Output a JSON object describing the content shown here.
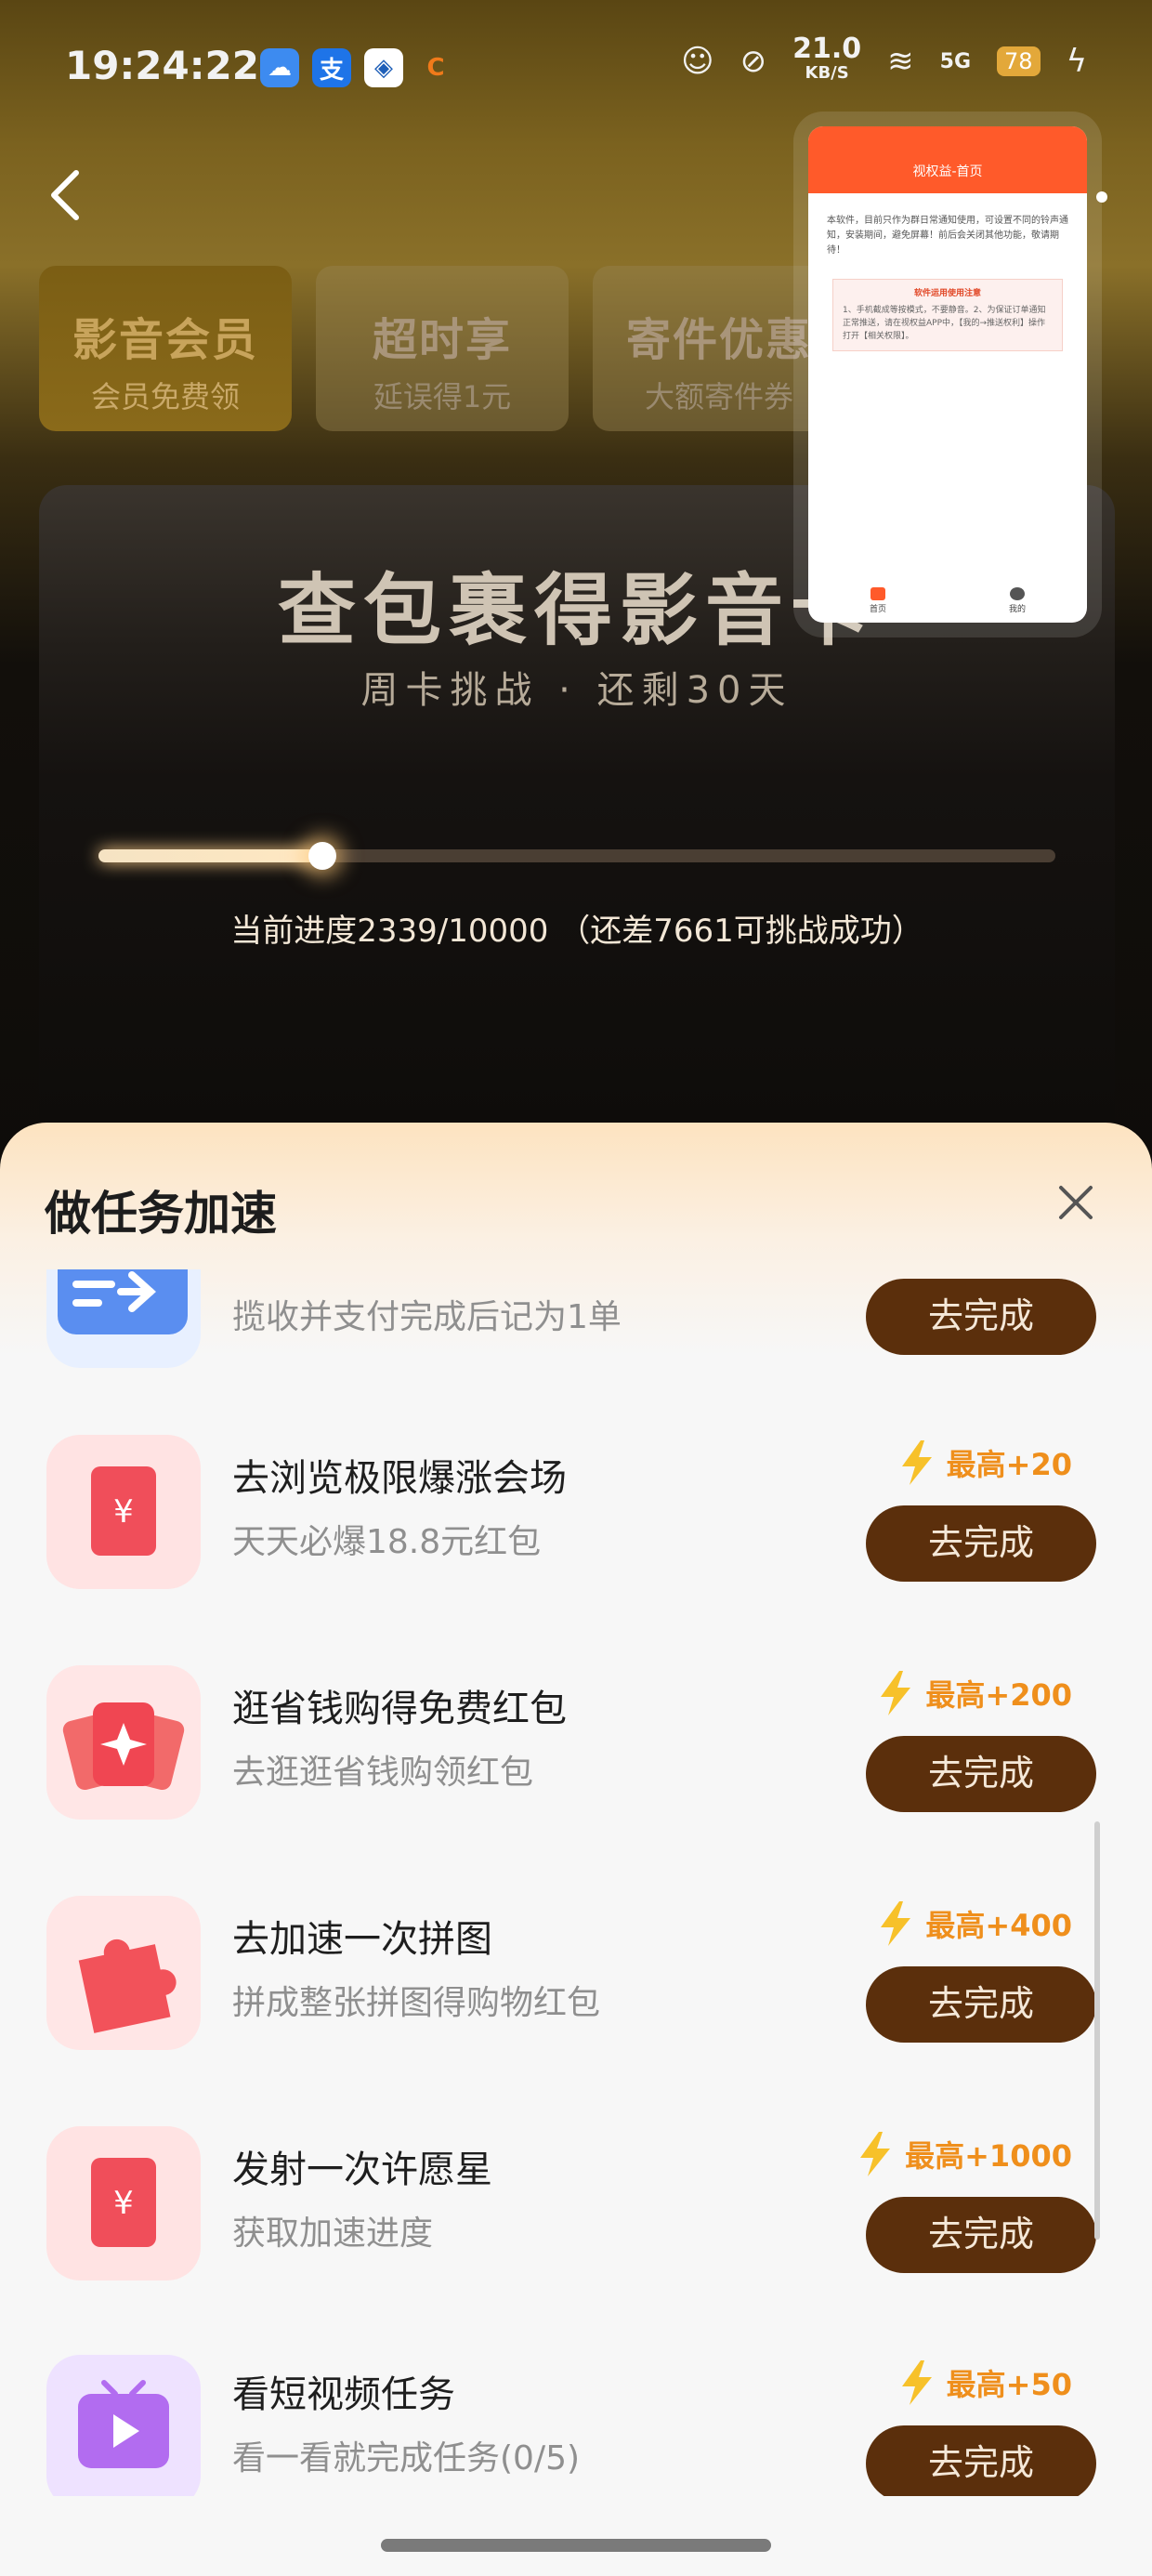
{
  "status_bar": {
    "time": "19:24:22",
    "net_speed_value": "21.0",
    "net_speed_unit": "KB/S",
    "signal": "5G",
    "battery": "78",
    "icons": [
      "weather-icon",
      "alipay-icon",
      "bank-icon",
      "app-icon",
      "cat-icon",
      "mute-icon",
      "wifi-icon",
      "signal-icon",
      "battery-icon",
      "charging-icon"
    ]
  },
  "tabs": [
    {
      "title": "影音会员",
      "subtitle": "会员免费领"
    },
    {
      "title": "超时享",
      "subtitle": "延误得1元"
    },
    {
      "title": "寄件优惠",
      "subtitle": "大额寄件券"
    }
  ],
  "hero": {
    "title": "查包裹得影音卡",
    "subtitle": "周卡挑战 · 还剩30天",
    "progress_current": 2339,
    "progress_total": 10000,
    "progress_text": "当前进度2339/10000 （还差7661可挑战成功）"
  },
  "mini_window": {
    "title": "视权益-首页",
    "paragraph": "本软件，目前只作为群日常通知使用，可设置不同的铃声通知，安装期间，避免屏幕！前后会关闭其他功能，敬请期待！",
    "notice_title": "软件运用使用注意",
    "notice_body": "1、手机截成等按模式，不要静音。2、为保证订单通知正常推送，请在视权益APP中，【我的→推送权利】操作打开【相关权限】。",
    "nav_home": "首页",
    "nav_me": "我的"
  },
  "sheet": {
    "title": "做任务加速",
    "tasks": [
      {
        "title": "",
        "subtitle": "揽收并支付完成后记为1单",
        "bonus": "",
        "button": "去完成"
      },
      {
        "title": "去浏览极限爆涨会场",
        "subtitle": "天天必爆18.8元红包",
        "bonus": "最高+20",
        "button": "去完成"
      },
      {
        "title": "逛省钱购得免费红包",
        "subtitle": "去逛逛省钱购领红包",
        "bonus": "最高+200",
        "button": "去完成"
      },
      {
        "title": "去加速一次拼图",
        "subtitle": "拼成整张拼图得购物红包",
        "bonus": "最高+400",
        "button": "去完成"
      },
      {
        "title": "发射一次许愿星",
        "subtitle": "获取加速进度",
        "bonus": "最高+1000",
        "button": "去完成"
      },
      {
        "title": "看短视频任务",
        "subtitle": "看一看就完成任务(0/5)",
        "bonus": "最高+50",
        "button": "去完成"
      }
    ]
  },
  "colors": {
    "accent_button": "#5b2f0c",
    "bonus_orange": "#ef8f1c",
    "mini_header": "#ff5a2a"
  }
}
